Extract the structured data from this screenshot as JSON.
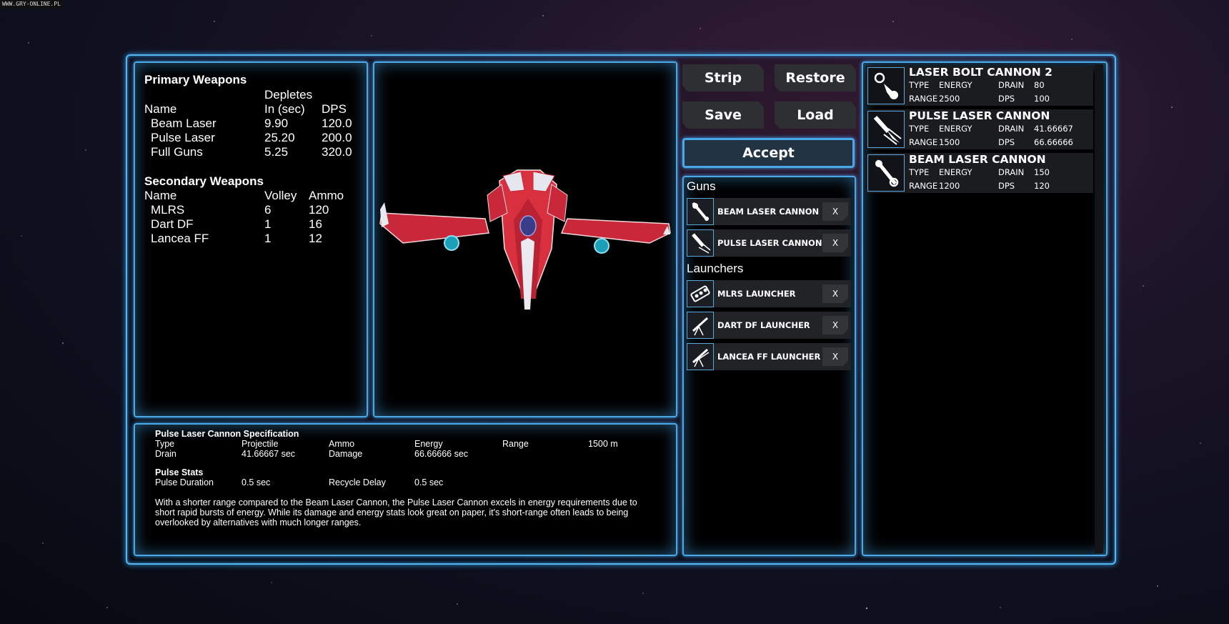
{
  "watermark": "WWW.GRY-ONLINE.PL",
  "colors": {
    "accent": "#4aa8e6",
    "panel_bg": "#000000",
    "button_bg": "#2e2f33"
  },
  "primary": {
    "title": "Primary Weapons",
    "header_top": "Depletes",
    "headers": [
      "Name",
      "In (sec)",
      "DPS"
    ],
    "rows": [
      {
        "name": "Beam Laser",
        "depletes": "9.90",
        "dps": "120.0"
      },
      {
        "name": "Pulse Laser",
        "depletes": "25.20",
        "dps": "200.0"
      },
      {
        "name": "Full Guns",
        "depletes": "5.25",
        "dps": "320.0"
      }
    ]
  },
  "secondary": {
    "title": "Secondary Weapons",
    "headers": [
      "Name",
      "Volley",
      "Ammo"
    ],
    "rows": [
      {
        "name": "MLRS",
        "volley": "6",
        "ammo": "120"
      },
      {
        "name": "Dart DF",
        "volley": "1",
        "ammo": "16"
      },
      {
        "name": "Lancea FF",
        "volley": "1",
        "ammo": "12"
      }
    ]
  },
  "buttons": {
    "strip": "Strip",
    "restore": "Restore",
    "save": "Save",
    "load": "Load",
    "accept": "Accept"
  },
  "loadout": {
    "guns_label": "Guns",
    "guns": [
      {
        "label": "BEAM LASER CANNON",
        "icon": "beam-laser-icon"
      },
      {
        "label": "PULSE LASER CANNON",
        "icon": "pulse-laser-icon"
      }
    ],
    "launchers_label": "Launchers",
    "launchers": [
      {
        "label": "MLRS LAUNCHER",
        "icon": "mlrs-launcher-icon"
      },
      {
        "label": "DART DF LAUNCHER",
        "icon": "dart-launcher-icon"
      },
      {
        "label": "LANCEA FF LAUNCHER",
        "icon": "lancea-launcher-icon"
      }
    ],
    "remove_label": "X"
  },
  "inventory": {
    "labels": {
      "type": "TYPE",
      "drain": "DRAIN",
      "range": "RANGE",
      "dps": "DPS"
    },
    "items": [
      {
        "name": "LASER BOLT CANNON 2",
        "type": "ENERGY",
        "drain": "80",
        "range": "2500",
        "dps": "100"
      },
      {
        "name": "PULSE LASER CANNON",
        "type": "ENERGY",
        "drain": "41.66667",
        "range": "1500",
        "dps": "66.66666"
      },
      {
        "name": "BEAM LASER CANNON",
        "type": "ENERGY",
        "drain": "150",
        "range": "1200",
        "dps": "120"
      }
    ]
  },
  "spec": {
    "title": "Pulse Laser Cannon Specification",
    "type_label": "Type",
    "type_value": "Projectile",
    "ammo_label": "Ammo",
    "ammo_value": "Energy",
    "range_label": "Range",
    "range_value": "1500 m",
    "drain_label": "Drain",
    "drain_value": "41.66667 sec",
    "damage_label": "Damage",
    "damage_value": "66.66666 sec",
    "pulse_title": "Pulse Stats",
    "pulse_duration_label": "Pulse Duration",
    "pulse_duration_value": "0.5 sec",
    "recycle_label": "Recycle Delay",
    "recycle_value": "0.5 sec",
    "description": "With a shorter range compared to the Beam Laser Cannon, the Pulse Laser Cannon excels in energy requirements due to short rapid bursts of energy. While its damage and energy stats look great on paper, it's short-range often leads to being overlooked by alternatives with much longer ranges."
  }
}
